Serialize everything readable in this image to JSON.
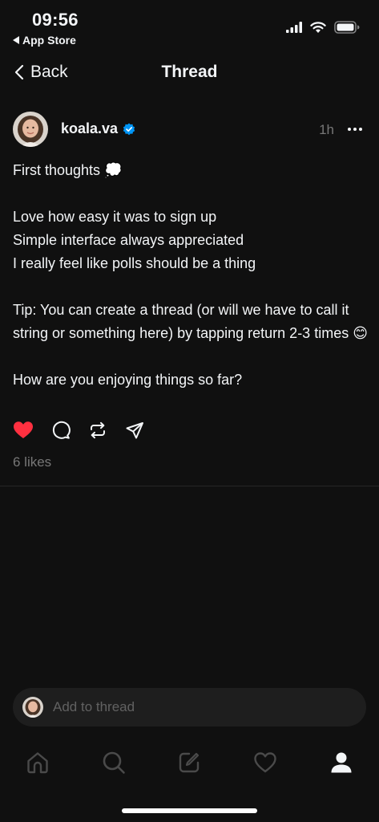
{
  "status_bar": {
    "time": "09:56",
    "back_app": "App Store",
    "icons": [
      "signal-icon",
      "wifi-icon",
      "battery-icon"
    ]
  },
  "nav": {
    "back_label": "Back",
    "title": "Thread"
  },
  "post": {
    "username": "koala.va",
    "verified": true,
    "time_ago": "1h",
    "paragraphs": [
      [
        "First thoughts 💭"
      ],
      [
        "Love how easy it was to sign up",
        "Simple interface always appreciated",
        "I really feel like polls should be a thing"
      ],
      [
        "Tip: You can create a thread (or will we have to call it string or something here) by tapping return 2-3 times 😊"
      ],
      [
        "How are you enjoying things so far?"
      ]
    ],
    "liked": true,
    "likes_text": "6 likes",
    "actions": [
      "heart-icon",
      "comment-icon",
      "repost-icon",
      "share-icon"
    ]
  },
  "reply": {
    "placeholder": "Add to thread"
  },
  "tabbar": {
    "items": [
      "home-icon",
      "search-icon",
      "compose-icon",
      "activity-icon",
      "profile-icon"
    ],
    "active": "profile-icon"
  },
  "colors": {
    "background": "#101010",
    "text": "#f3f5f7",
    "muted": "#777777",
    "like_red": "#ff3040",
    "verified_blue": "#0095f6",
    "reply_bar": "#1e1e1e"
  }
}
